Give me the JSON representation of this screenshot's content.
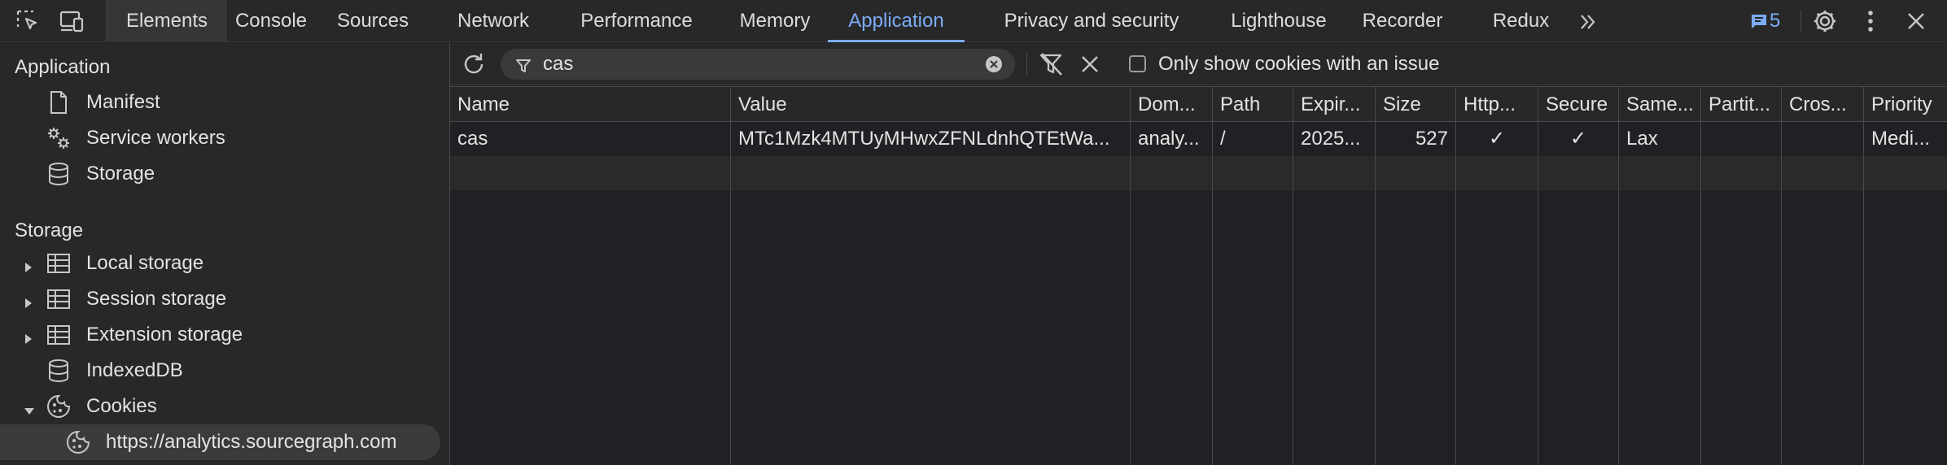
{
  "tabs": [
    "Elements",
    "Console",
    "Sources",
    "Network",
    "Performance",
    "Memory",
    "Application",
    "Privacy and security",
    "Lighthouse",
    "Recorder",
    "Redux"
  ],
  "active_tab": "Application",
  "issues_count": "5",
  "sidebar": {
    "application_heading": "Application",
    "application_items": [
      {
        "label": "Manifest",
        "icon": "document-icon"
      },
      {
        "label": "Service workers",
        "icon": "gears-icon"
      },
      {
        "label": "Storage",
        "icon": "database-icon"
      }
    ],
    "storage_heading": "Storage",
    "storage_items": [
      {
        "label": "Local storage",
        "icon": "table-icon"
      },
      {
        "label": "Session storage",
        "icon": "table-icon"
      },
      {
        "label": "Extension storage",
        "icon": "table-icon"
      },
      {
        "label": "IndexedDB",
        "icon": "database-icon"
      },
      {
        "label": "Cookies",
        "icon": "cookie-icon"
      }
    ],
    "cookie_origin": "https://analytics.sourcegraph.com"
  },
  "toolbar": {
    "filter_value": "cas",
    "only_issues_label": "Only show cookies with an issue"
  },
  "table": {
    "headers": [
      "Name",
      "Value",
      "Dom...",
      "Path",
      "Expir...",
      "Size",
      "Http...",
      "Secure",
      "Same...",
      "Partit...",
      "Cros...",
      "Priority"
    ],
    "rows": [
      [
        "cas",
        "MTc1Mzk4MTUyMHwxZFNLdnhQTEtWa...",
        "analy...",
        "/",
        "2025...",
        "527",
        "✓",
        "✓",
        "Lax",
        "",
        "",
        "Medi..."
      ]
    ]
  },
  "colors": {
    "accent": "#7cacf8",
    "background": "#202124",
    "panel": "#282828"
  }
}
